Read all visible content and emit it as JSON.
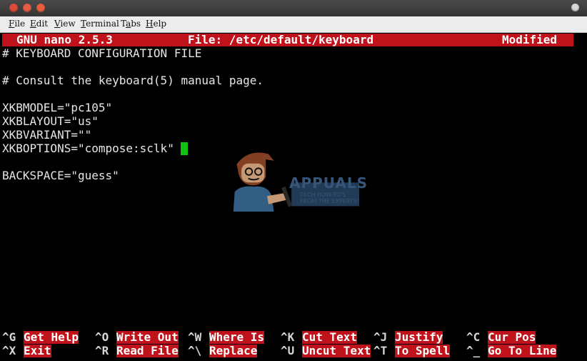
{
  "menubar": {
    "items": [
      "File",
      "Edit",
      "View",
      "Terminal",
      "Tabs",
      "Help"
    ]
  },
  "nano": {
    "version": "GNU nano 2.5.3",
    "file": "File: /etc/default/keyboard",
    "status": "Modified"
  },
  "file_lines": [
    "# KEYBOARD CONFIGURATION FILE",
    "",
    "# Consult the keyboard(5) manual page.",
    "",
    "XKBMODEL=\"pc105\"",
    "XKBLAYOUT=\"us\"",
    "XKBVARIANT=\"\"",
    "XKBOPTIONS=\"compose:sclk\"",
    "",
    "BACKSPACE=\"guess\""
  ],
  "shortcuts_row1": [
    {
      "key": "^G",
      "label": "Get Help"
    },
    {
      "key": "^O",
      "label": "Write Out"
    },
    {
      "key": "^W",
      "label": "Where Is"
    },
    {
      "key": "^K",
      "label": "Cut Text"
    },
    {
      "key": "^J",
      "label": "Justify"
    },
    {
      "key": "^C",
      "label": "Cur Pos"
    }
  ],
  "shortcuts_row2": [
    {
      "key": "^X",
      "label": "Exit"
    },
    {
      "key": "^R",
      "label": "Read File"
    },
    {
      "key": "^\\",
      "label": "Replace"
    },
    {
      "key": "^U",
      "label": "Uncut Text"
    },
    {
      "key": "^T",
      "label": "To Spell"
    },
    {
      "key": "^_",
      "label": "Go To Line"
    }
  ],
  "watermark": {
    "brand": "APPUALS",
    "tagline": "TECH HOW-TO'S FROM THE EXPERTS!"
  },
  "colors": {
    "header_bg": "#c0121a",
    "cursor": "#13c113",
    "terminal_bg": "#000000"
  }
}
